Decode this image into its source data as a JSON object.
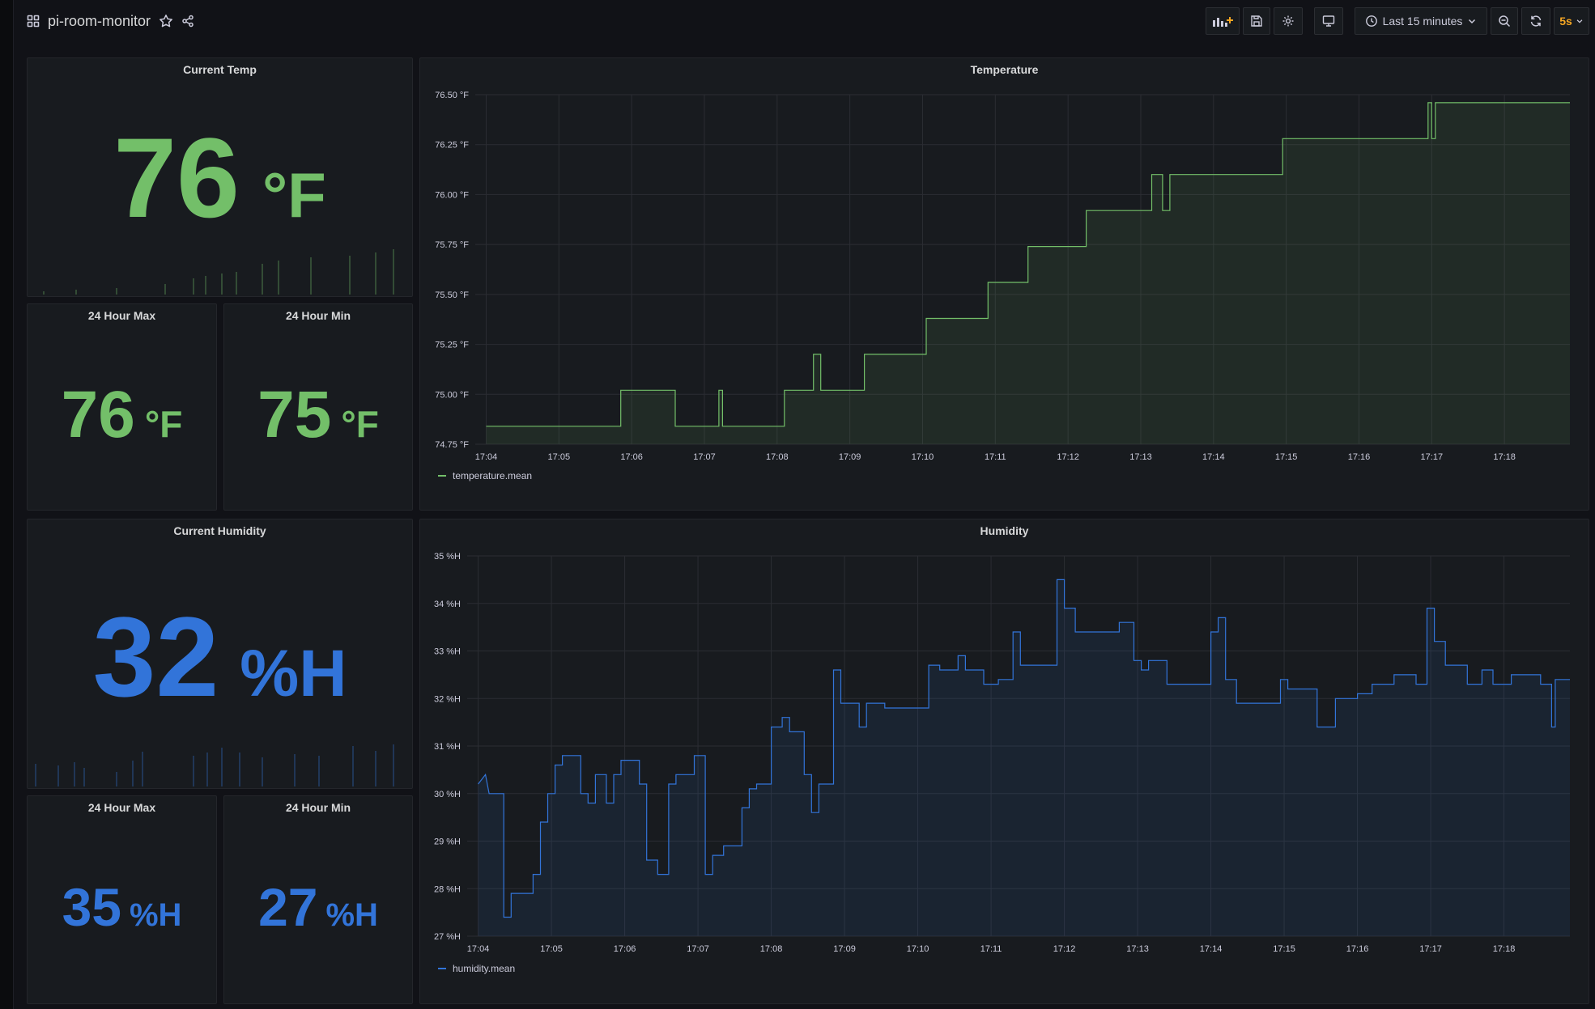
{
  "header": {
    "title": "pi-room-monitor",
    "time_range": "Last 15 minutes",
    "refresh": "5s"
  },
  "colors": {
    "green": "#73bf69",
    "blue": "#3274d9",
    "panel_bg": "#181b1f",
    "bg": "#111217",
    "accent": "#f5a623"
  },
  "icons": [
    "apps-icon",
    "star-icon",
    "share-icon",
    "add-panel-icon",
    "save-icon",
    "settings-icon",
    "tv-icon",
    "clock-icon",
    "chevron-down-icon",
    "zoom-out-icon",
    "refresh-icon"
  ],
  "panels": {
    "current_temp": {
      "title": "Current Temp",
      "value": "76",
      "unit": "°F"
    },
    "temp_max": {
      "title": "24 Hour Max",
      "value": "76",
      "unit": "°F"
    },
    "temp_min": {
      "title": "24 Hour Min",
      "value": "75",
      "unit": "°F"
    },
    "temperature": {
      "title": "Temperature",
      "legend": "temperature.mean"
    },
    "current_humidity": {
      "title": "Current Humidity",
      "value": "32",
      "unit": "%H"
    },
    "hum_max": {
      "title": "24 Hour Max",
      "value": "35",
      "unit": "%H"
    },
    "hum_min": {
      "title": "24 Hour Min",
      "value": "27",
      "unit": "%H"
    },
    "humidity": {
      "title": "Humidity",
      "legend": "humidity.mean"
    }
  },
  "chart_data": [
    {
      "type": "line",
      "title": "Temperature",
      "series": [
        {
          "name": "temperature.mean",
          "color": "#73bf69",
          "points": [
            [
              0,
              74.84
            ],
            [
              1.85,
              74.84
            ],
            [
              1.85,
              75.02
            ],
            [
              2.6,
              75.02
            ],
            [
              2.6,
              74.84
            ],
            [
              3.2,
              74.84
            ],
            [
              3.2,
              75.02
            ],
            [
              3.25,
              75.02
            ],
            [
              3.25,
              74.84
            ],
            [
              4.1,
              74.84
            ],
            [
              4.1,
              75.02
            ],
            [
              4.5,
              75.02
            ],
            [
              4.5,
              75.2
            ],
            [
              4.6,
              75.2
            ],
            [
              4.6,
              75.02
            ],
            [
              5.2,
              75.02
            ],
            [
              5.2,
              75.2
            ],
            [
              6.05,
              75.2
            ],
            [
              6.05,
              75.38
            ],
            [
              6.9,
              75.38
            ],
            [
              6.9,
              75.56
            ],
            [
              7.45,
              75.56
            ],
            [
              7.45,
              75.74
            ],
            [
              8.25,
              75.74
            ],
            [
              8.25,
              75.92
            ],
            [
              9.15,
              75.92
            ],
            [
              9.15,
              76.1
            ],
            [
              9.3,
              76.1
            ],
            [
              9.3,
              75.92
            ],
            [
              9.4,
              75.92
            ],
            [
              9.4,
              76.1
            ],
            [
              10.95,
              76.1
            ],
            [
              10.95,
              76.28
            ],
            [
              12.95,
              76.28
            ],
            [
              12.95,
              76.46
            ],
            [
              13.0,
              76.46
            ],
            [
              13.0,
              76.28
            ],
            [
              13.05,
              76.28
            ],
            [
              13.05,
              76.46
            ],
            [
              14.9,
              76.46
            ]
          ]
        }
      ],
      "y_ticks": [
        "74.75 °F",
        "75.00 °F",
        "75.25 °F",
        "75.50 °F",
        "75.75 °F",
        "76.00 °F",
        "76.25 °F",
        "76.50 °F"
      ],
      "ylim": [
        74.75,
        76.5
      ],
      "x_ticks": [
        "17:04",
        "17:05",
        "17:06",
        "17:07",
        "17:08",
        "17:09",
        "17:10",
        "17:11",
        "17:12",
        "17:13",
        "17:14",
        "17:15",
        "17:16",
        "17:17",
        "17:18"
      ],
      "legend_placement": "bottom-left",
      "grid": true
    },
    {
      "type": "line",
      "title": "Humidity",
      "series": [
        {
          "name": "humidity.mean",
          "color": "#3274d9",
          "points": [
            [
              0,
              30.2
            ],
            [
              0.1,
              30.4
            ],
            [
              0.15,
              30.0
            ],
            [
              0.35,
              30.0
            ],
            [
              0.35,
              27.4
            ],
            [
              0.45,
              27.4
            ],
            [
              0.45,
              27.9
            ],
            [
              0.75,
              27.9
            ],
            [
              0.75,
              28.3
            ],
            [
              0.85,
              28.3
            ],
            [
              0.85,
              29.4
            ],
            [
              0.95,
              29.4
            ],
            [
              0.95,
              30.0
            ],
            [
              1.05,
              30.0
            ],
            [
              1.05,
              30.6
            ],
            [
              1.15,
              30.6
            ],
            [
              1.15,
              30.8
            ],
            [
              1.4,
              30.8
            ],
            [
              1.4,
              30.0
            ],
            [
              1.5,
              30.0
            ],
            [
              1.5,
              29.8
            ],
            [
              1.6,
              29.8
            ],
            [
              1.6,
              30.4
            ],
            [
              1.75,
              30.4
            ],
            [
              1.75,
              29.8
            ],
            [
              1.85,
              29.8
            ],
            [
              1.85,
              30.4
            ],
            [
              1.95,
              30.4
            ],
            [
              1.95,
              30.7
            ],
            [
              2.2,
              30.7
            ],
            [
              2.2,
              30.2
            ],
            [
              2.3,
              30.2
            ],
            [
              2.3,
              28.6
            ],
            [
              2.45,
              28.6
            ],
            [
              2.45,
              28.3
            ],
            [
              2.6,
              28.3
            ],
            [
              2.6,
              30.2
            ],
            [
              2.7,
              30.2
            ],
            [
              2.7,
              30.4
            ],
            [
              2.95,
              30.4
            ],
            [
              2.95,
              30.8
            ],
            [
              3.1,
              30.8
            ],
            [
              3.1,
              28.3
            ],
            [
              3.2,
              28.3
            ],
            [
              3.2,
              28.7
            ],
            [
              3.35,
              28.7
            ],
            [
              3.35,
              28.9
            ],
            [
              3.6,
              28.9
            ],
            [
              3.6,
              29.7
            ],
            [
              3.7,
              29.7
            ],
            [
              3.7,
              30.1
            ],
            [
              3.8,
              30.1
            ],
            [
              3.8,
              30.2
            ],
            [
              4.0,
              30.2
            ],
            [
              4.0,
              31.4
            ],
            [
              4.15,
              31.4
            ],
            [
              4.15,
              31.6
            ],
            [
              4.25,
              31.6
            ],
            [
              4.25,
              31.3
            ],
            [
              4.45,
              31.3
            ],
            [
              4.45,
              30.4
            ],
            [
              4.55,
              30.4
            ],
            [
              4.55,
              29.6
            ],
            [
              4.65,
              29.6
            ],
            [
              4.65,
              30.2
            ],
            [
              4.85,
              30.2
            ],
            [
              4.85,
              32.6
            ],
            [
              4.95,
              32.6
            ],
            [
              4.95,
              31.9
            ],
            [
              5.2,
              31.9
            ],
            [
              5.2,
              31.4
            ],
            [
              5.3,
              31.4
            ],
            [
              5.3,
              31.9
            ],
            [
              5.55,
              31.9
            ],
            [
              5.55,
              31.8
            ],
            [
              6.15,
              31.8
            ],
            [
              6.15,
              32.7
            ],
            [
              6.3,
              32.7
            ],
            [
              6.3,
              32.6
            ],
            [
              6.55,
              32.6
            ],
            [
              6.55,
              32.9
            ],
            [
              6.65,
              32.9
            ],
            [
              6.65,
              32.6
            ],
            [
              6.9,
              32.6
            ],
            [
              6.9,
              32.3
            ],
            [
              7.1,
              32.3
            ],
            [
              7.1,
              32.4
            ],
            [
              7.3,
              32.4
            ],
            [
              7.3,
              33.4
            ],
            [
              7.4,
              33.4
            ],
            [
              7.4,
              32.7
            ],
            [
              7.9,
              32.7
            ],
            [
              7.9,
              34.5
            ],
            [
              8.0,
              34.5
            ],
            [
              8.0,
              33.9
            ],
            [
              8.15,
              33.9
            ],
            [
              8.15,
              33.4
            ],
            [
              8.75,
              33.4
            ],
            [
              8.75,
              33.6
            ],
            [
              8.95,
              33.6
            ],
            [
              8.95,
              32.8
            ],
            [
              9.05,
              32.8
            ],
            [
              9.05,
              32.6
            ],
            [
              9.15,
              32.6
            ],
            [
              9.15,
              32.8
            ],
            [
              9.4,
              32.8
            ],
            [
              9.4,
              32.3
            ],
            [
              10.0,
              32.3
            ],
            [
              10.0,
              33.4
            ],
            [
              10.1,
              33.4
            ],
            [
              10.1,
              33.7
            ],
            [
              10.2,
              33.7
            ],
            [
              10.2,
              32.4
            ],
            [
              10.35,
              32.4
            ],
            [
              10.35,
              31.9
            ],
            [
              10.95,
              31.9
            ],
            [
              10.95,
              32.4
            ],
            [
              11.05,
              32.4
            ],
            [
              11.05,
              32.2
            ],
            [
              11.45,
              32.2
            ],
            [
              11.45,
              31.4
            ],
            [
              11.7,
              31.4
            ],
            [
              11.7,
              32.0
            ],
            [
              12.0,
              32.0
            ],
            [
              12.0,
              32.1
            ],
            [
              12.2,
              32.1
            ],
            [
              12.2,
              32.3
            ],
            [
              12.5,
              32.3
            ],
            [
              12.5,
              32.5
            ],
            [
              12.8,
              32.5
            ],
            [
              12.8,
              32.3
            ],
            [
              12.95,
              32.3
            ],
            [
              12.95,
              33.9
            ],
            [
              13.05,
              33.9
            ],
            [
              13.05,
              33.2
            ],
            [
              13.2,
              33.2
            ],
            [
              13.2,
              32.7
            ],
            [
              13.5,
              32.7
            ],
            [
              13.5,
              32.3
            ],
            [
              13.7,
              32.3
            ],
            [
              13.7,
              32.6
            ],
            [
              13.85,
              32.6
            ],
            [
              13.85,
              32.3
            ],
            [
              14.1,
              32.3
            ],
            [
              14.1,
              32.5
            ],
            [
              14.5,
              32.5
            ],
            [
              14.5,
              32.3
            ],
            [
              14.65,
              32.3
            ],
            [
              14.65,
              31.4
            ],
            [
              14.7,
              31.4
            ],
            [
              14.7,
              32.4
            ],
            [
              14.9,
              32.4
            ]
          ]
        }
      ],
      "y_ticks": [
        "27 %H",
        "28 %H",
        "29 %H",
        "30 %H",
        "31 %H",
        "32 %H",
        "33 %H",
        "34 %H",
        "35 %H"
      ],
      "ylim": [
        27,
        35
      ],
      "x_ticks": [
        "17:04",
        "17:05",
        "17:06",
        "17:07",
        "17:08",
        "17:09",
        "17:10",
        "17:11",
        "17:12",
        "17:13",
        "17:14",
        "17:15",
        "17:16",
        "17:17",
        "17:18"
      ],
      "legend_placement": "bottom-left",
      "grid": true
    }
  ]
}
